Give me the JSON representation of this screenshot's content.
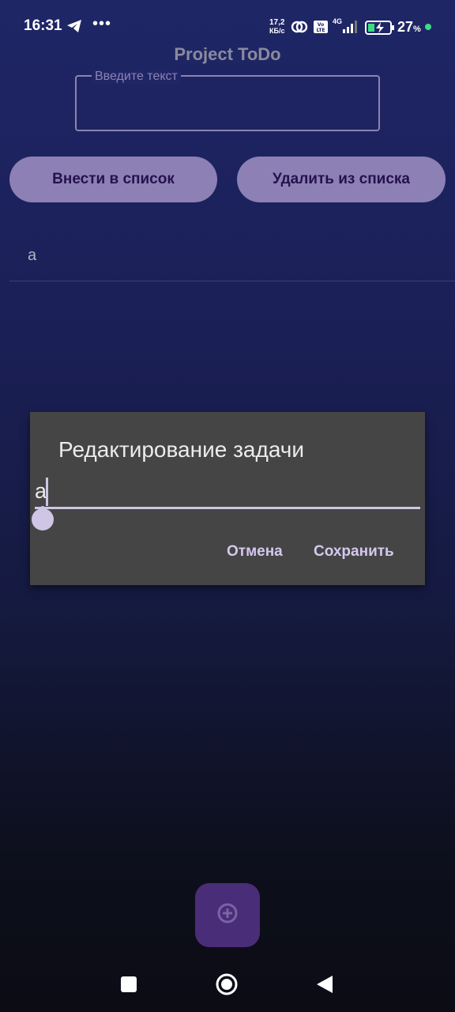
{
  "status_bar": {
    "time": "16:31",
    "dots": "•••",
    "net_speed_value": "17,2",
    "net_speed_unit": "КБ/с",
    "network": "4G",
    "volte": "Vo LTE",
    "battery_percent": "27",
    "battery_symbol": "%",
    "icons": [
      "telegram-icon",
      "link-icon",
      "volte-icon",
      "signal-icon",
      "battery-charging-icon"
    ]
  },
  "app": {
    "title": "Project ToDo",
    "input": {
      "label": "Введите текст",
      "value": ""
    },
    "buttons": {
      "add": "Внести в список",
      "remove": "Удалить из списка"
    },
    "list": [
      {
        "text": "а"
      }
    ]
  },
  "dialog": {
    "title": "Редактирование задачи",
    "input_value": "а",
    "cancel": "Отмена",
    "save": "Сохранить"
  },
  "fab": {
    "icon": "add-circle-icon"
  },
  "nav": {
    "icons": [
      "recents-icon",
      "home-icon",
      "back-icon"
    ]
  },
  "colors": {
    "accent": "#8c80b4",
    "fab": "#4a2d78",
    "dialog_bg": "#454545",
    "dialog_action": "#d4c8f0"
  }
}
